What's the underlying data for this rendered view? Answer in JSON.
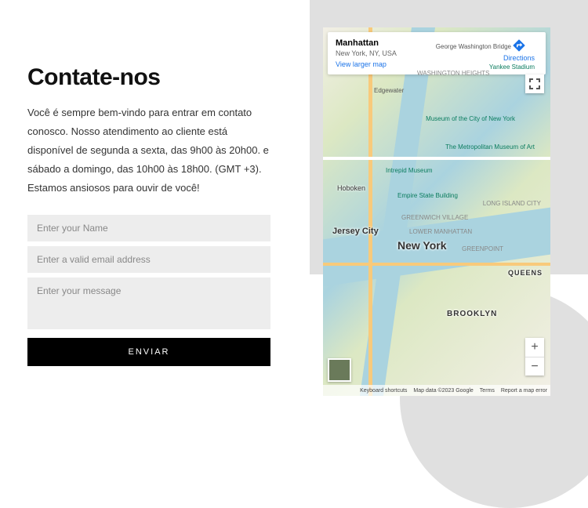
{
  "heading": "Contate-nos",
  "description": "Você é sempre bem-vindo para entrar em contato conosco. Nosso atendimento ao cliente está disponível de segunda a sexta, das 9h00 às 20h00. e sábado a domingo, das 10h00 às 18h00. (GMT +3). Estamos ansiosos para ouvir de você!",
  "form": {
    "name_placeholder": "Enter your Name",
    "email_placeholder": "Enter a valid email address",
    "message_placeholder": "Enter your message",
    "submit_label": "ENVIAR"
  },
  "map": {
    "info_title": "Manhattan",
    "info_subtitle": "New York, NY, USA",
    "view_larger": "View larger map",
    "directions": "Directions",
    "labels": {
      "newyork": "New York",
      "jerseycity": "Jersey City",
      "brooklyn": "BROOKLYN",
      "hoboken": "Hoboken",
      "queens": "QUEENS"
    },
    "pois": {
      "yankee": "Yankee Stadium",
      "museum": "Museum of the City of New York",
      "met": "The Metropolitan Museum of Art",
      "intrepid": "Intrepid Museum",
      "empire": "Empire State Building",
      "edgewater": "Edgewater",
      "wh": "WASHINGTON HEIGHTS",
      "gwb": "George Washington Bridge",
      "greenpoint": "GREENPOINT",
      "lic": "LONG ISLAND CITY",
      "gv": "GREENWICH VILLAGE",
      "lm": "LOWER MANHATTAN"
    },
    "footer": {
      "shortcuts": "Keyboard shortcuts",
      "data": "Map data ©2023 Google",
      "terms": "Terms",
      "report": "Report a map error"
    }
  }
}
